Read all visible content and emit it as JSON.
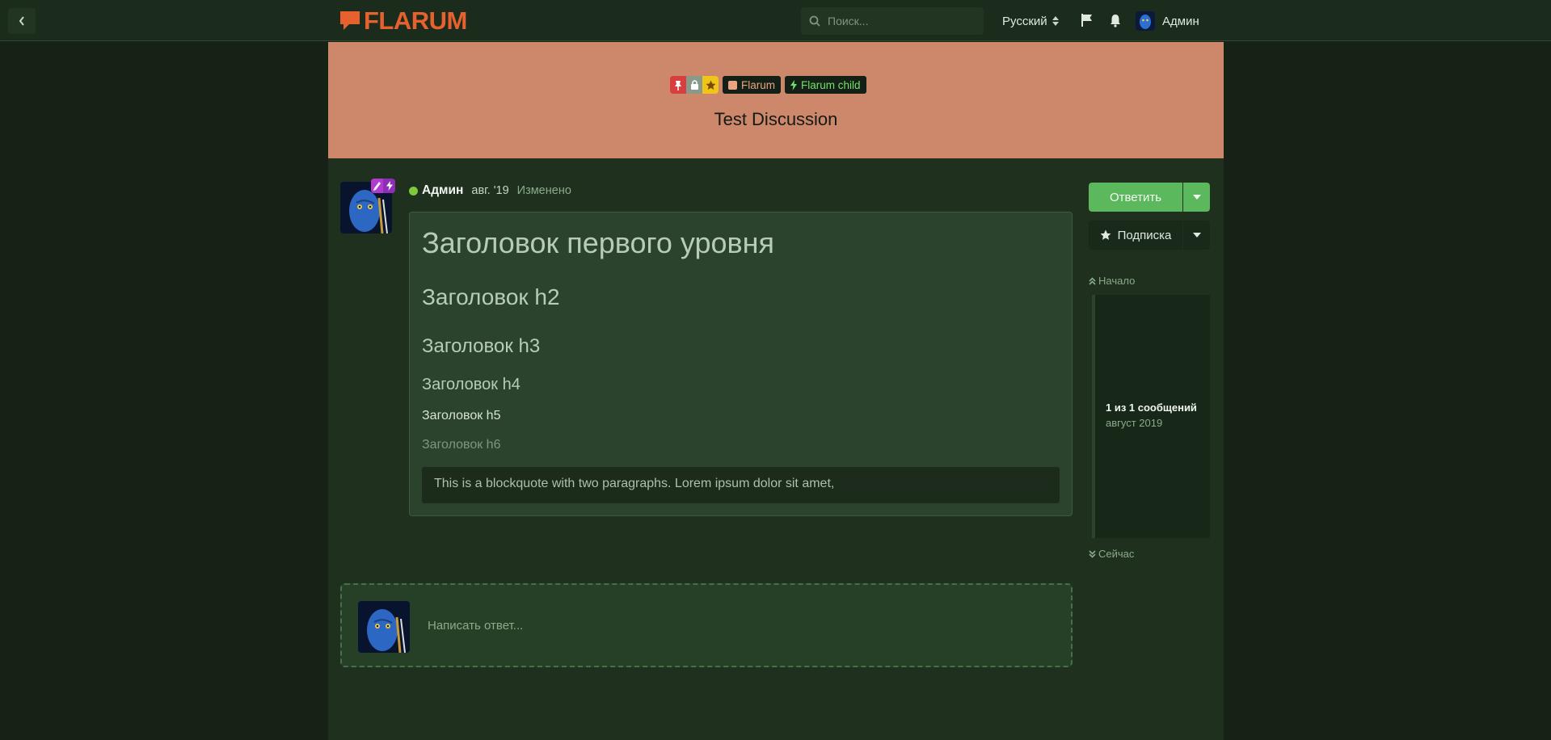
{
  "header": {
    "logo_text": "FLARUM",
    "search_placeholder": "Поиск...",
    "language": "Русский",
    "username": "Админ"
  },
  "discussion": {
    "title": "Test Discussion",
    "tags": [
      {
        "label": "Flarum",
        "color": "#e8a483"
      },
      {
        "label": "Flarum child",
        "color": "#74e06c"
      }
    ],
    "status_badges": [
      "pin-icon",
      "lock-icon",
      "star-icon"
    ]
  },
  "post": {
    "user": "Админ",
    "date": "авг. '19",
    "edited": "Изменено",
    "content": {
      "h1": "Заголовок первого уровня",
      "h2": "Заголовок h2",
      "h3": "Заголовок h3",
      "h4": "Заголовок h4",
      "h5": "Заголовок h5",
      "h6": "Заголовок h6",
      "blockquote": "This is a blockquote with two paragraphs. Lorem ipsum dolor sit amet,"
    }
  },
  "sidebar": {
    "reply_label": "Ответить",
    "subscribe_label": "Подписка",
    "scrubber_start": "Начало",
    "scrubber_count": "1 из 1 сообщений",
    "scrubber_date": "август 2019",
    "scrubber_now": "Сейчас"
  },
  "composer": {
    "placeholder": "Написать ответ..."
  },
  "colors": {
    "accent": "#5cb85c",
    "hero": "#cd876a",
    "logo": "#e7612f",
    "background": "#152215"
  }
}
